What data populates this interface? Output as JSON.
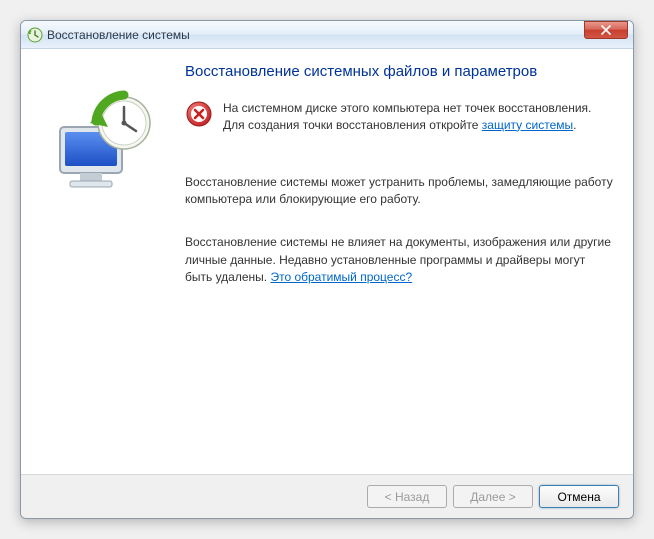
{
  "window": {
    "title": "Восстановление системы"
  },
  "content": {
    "heading": "Восстановление системных файлов и параметров",
    "error_text_1": "На системном диске этого компьютера нет точек восстановления. Для создания точки восстановления откройте ",
    "error_link": "защиту системы",
    "error_text_2": ".",
    "para1": "Восстановление системы может устранить проблемы, замедляющие работу компьютера или блокирующие его работу.",
    "para2_part1": "Восстановление системы не влияет на документы, изображения или другие личные данные. Недавно установленные программы и драйверы могут быть удалены. ",
    "para2_link": "Это обратимый процесс?"
  },
  "buttons": {
    "back": "< Назад",
    "next": "Далее >",
    "cancel": "Отмена"
  }
}
